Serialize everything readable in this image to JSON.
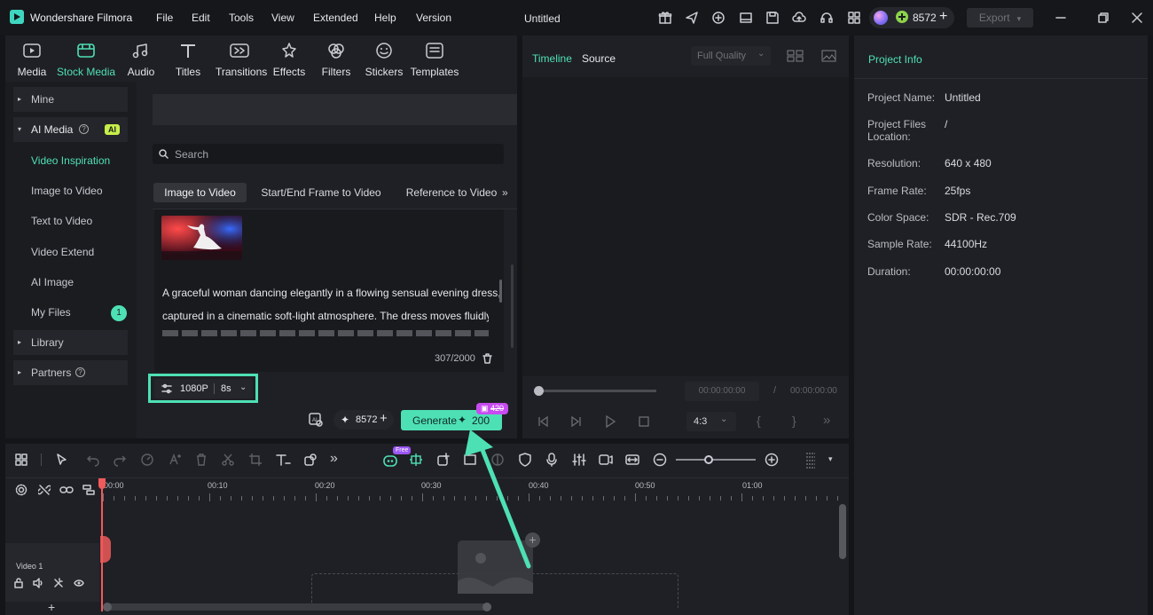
{
  "titlebar": {
    "app_name": "Wondershare Filmora",
    "menu": [
      "File",
      "Edit",
      "Tools",
      "View",
      "Extended",
      "Help",
      "Version"
    ],
    "doc_title": "Untitled",
    "credits": "8572",
    "export_label": "Export"
  },
  "media_tools": [
    {
      "label": "Media",
      "icon": "media-icon"
    },
    {
      "label": "Stock Media",
      "icon": "stock-media-icon",
      "active": true
    },
    {
      "label": "Audio",
      "icon": "music-note-icon"
    },
    {
      "label": "Titles",
      "icon": "text-t-icon"
    },
    {
      "label": "Transitions",
      "icon": "transitions-icon"
    },
    {
      "label": "Effects",
      "icon": "effects-sparkle-icon"
    },
    {
      "label": "Filters",
      "icon": "filters-icon"
    },
    {
      "label": "Stickers",
      "icon": "stickers-icon"
    },
    {
      "label": "Templates",
      "icon": "templates-icon"
    }
  ],
  "sidebar": {
    "mine": "Mine",
    "ai_media": "AI Media",
    "ai_badge": "AI",
    "items": [
      "Video Inspiration",
      "Image to Video",
      "Text to Video",
      "Video Extend",
      "AI Image",
      "My Files"
    ],
    "my_files_count": "1",
    "library": "Library",
    "partners": "Partners"
  },
  "ai_panel": {
    "search_placeholder": "Search",
    "tabs": [
      "Image to Video",
      "Start/End Frame to Video",
      "Reference to Video"
    ],
    "prompt_line1": "A graceful woman dancing elegantly in a flowing sensual evening dress,",
    "prompt_line2": "captured in a cinematic soft-light atmosphere. The dress moves fluidly wi",
    "char_count": "307/2000",
    "resolution": "1080P",
    "duration": "8s",
    "credits": "8572",
    "generate_label": "Generate",
    "generate_cost": "200",
    "badge_cost": "420"
  },
  "player": {
    "tab_timeline": "Timeline",
    "tab_source": "Source",
    "quality": "Full Quality",
    "time_current": "00:00:00:00",
    "time_sep": "/",
    "time_total": "00:00:00:00",
    "aspect": "4:3"
  },
  "project_info": {
    "title": "Project Info",
    "rows": [
      {
        "label": "Project Name:",
        "value": "Untitled"
      },
      {
        "label": "Project Files Location:",
        "value": "/"
      },
      {
        "label": "Resolution:",
        "value": "640 x 480"
      },
      {
        "label": "Frame Rate:",
        "value": "25fps"
      },
      {
        "label": "Color Space:",
        "value": "SDR - Rec.709"
      },
      {
        "label": "Sample Rate:",
        "value": "44100Hz"
      },
      {
        "label": "Duration:",
        "value": "00:00:00:00"
      }
    ]
  },
  "timeline": {
    "ticks": [
      "00:00",
      "00:10",
      "00:20",
      "00:30",
      "00:40",
      "00:50",
      "01:00"
    ],
    "track_label": "Video 1",
    "free_badge": "Free"
  },
  "colors": {
    "accent": "#4ee0b5",
    "background": "#141519",
    "panel": "#1f2025",
    "playhead": "#f05a5a"
  }
}
